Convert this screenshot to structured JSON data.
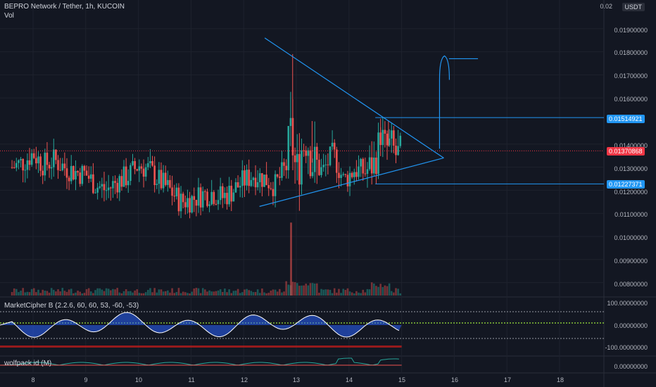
{
  "header": {
    "title": "BEPRO Network / Tether, 1h, KUCOIN",
    "vol_label": "Vol"
  },
  "price_axis": {
    "unit": "USDT",
    "top_label": "0.02",
    "labels": [
      "0.01900000",
      "0.01800000",
      "0.01700000",
      "0.01600000",
      "0.01400000",
      "0.01300000",
      "0.01200000",
      "0.01100000",
      "0.01000000",
      "0.00900000",
      "0.00800000"
    ]
  },
  "price_tags": {
    "resistance": "0.01514921",
    "last": "0.01370868",
    "support": "0.01227371"
  },
  "indicators": {
    "market_cipher": {
      "title": "MarketCipher B (2.2.6, 60, 60, 53, -60, -53)",
      "levels": [
        "100.00000000",
        "0.00000000",
        "-100.00000000"
      ]
    },
    "wolfpack": {
      "title": "wolfpack id (M)",
      "level": "0.00000000"
    }
  },
  "time_axis": {
    "labels": [
      "8",
      "9",
      "10",
      "11",
      "12",
      "13",
      "14",
      "15",
      "16",
      "17",
      "18"
    ]
  },
  "colors": {
    "background": "#131722",
    "up": "#26a69a",
    "down": "#ef5350",
    "drawing": "#2196f3",
    "last_price": "#f23645",
    "grid": "#1e222d"
  },
  "chart_data": {
    "type": "candlestick",
    "title": "BEPRO Network / Tether, 1h, KUCOIN",
    "y_unit": "USDT",
    "y_range": [
      0.0076,
      0.02
    ],
    "x_range": [
      7.6,
      18.5
    ],
    "last_price": 0.01370868,
    "horizontal_levels": [
      0.01514921,
      0.01227371
    ],
    "price_path": [
      [
        7.6,
        0.013
      ],
      [
        7.8,
        0.0132
      ],
      [
        8.0,
        0.0136
      ],
      [
        8.2,
        0.0131
      ],
      [
        8.4,
        0.0133
      ],
      [
        8.6,
        0.013
      ],
      [
        8.8,
        0.0128
      ],
      [
        9.0,
        0.0127
      ],
      [
        9.2,
        0.0122
      ],
      [
        9.4,
        0.012
      ],
      [
        9.6,
        0.0124
      ],
      [
        9.8,
        0.0126
      ],
      [
        10.0,
        0.0131
      ],
      [
        10.2,
        0.0129
      ],
      [
        10.4,
        0.0124
      ],
      [
        10.6,
        0.012
      ],
      [
        10.8,
        0.0115
      ],
      [
        11.0,
        0.0116
      ],
      [
        11.2,
        0.0118
      ],
      [
        11.4,
        0.0119
      ],
      [
        11.6,
        0.0117
      ],
      [
        11.8,
        0.012
      ],
      [
        12.0,
        0.0124
      ],
      [
        12.2,
        0.0127
      ],
      [
        12.4,
        0.0125
      ],
      [
        12.6,
        0.0122
      ],
      [
        12.8,
        0.013
      ],
      [
        12.9,
        0.0145
      ],
      [
        13.0,
        0.0126
      ],
      [
        13.1,
        0.0138
      ],
      [
        13.2,
        0.0144
      ],
      [
        13.3,
        0.0132
      ],
      [
        13.5,
        0.0128
      ],
      [
        13.7,
        0.0136
      ],
      [
        13.9,
        0.0124
      ],
      [
        14.1,
        0.0129
      ],
      [
        14.3,
        0.0128
      ],
      [
        14.5,
        0.0132
      ],
      [
        14.6,
        0.0145
      ],
      [
        14.7,
        0.0138
      ],
      [
        14.8,
        0.014
      ],
      [
        14.9,
        0.0135
      ],
      [
        15.0,
        0.0137
      ]
    ],
    "wick_highs": [
      [
        12.93,
        0.0179
      ],
      [
        13.3,
        0.015
      ],
      [
        14.6,
        0.0151
      ],
      [
        14.75,
        0.015
      ]
    ],
    "volume_spikes": [
      [
        12.9,
        0.0106
      ]
    ],
    "triangle": {
      "upper": [
        [
          12.4,
          0.0186
        ],
        [
          15.8,
          0.0134
        ]
      ],
      "lower": [
        [
          12.3,
          0.0113
        ],
        [
          15.8,
          0.0134
        ]
      ]
    },
    "projection_top": 0.0177
  }
}
